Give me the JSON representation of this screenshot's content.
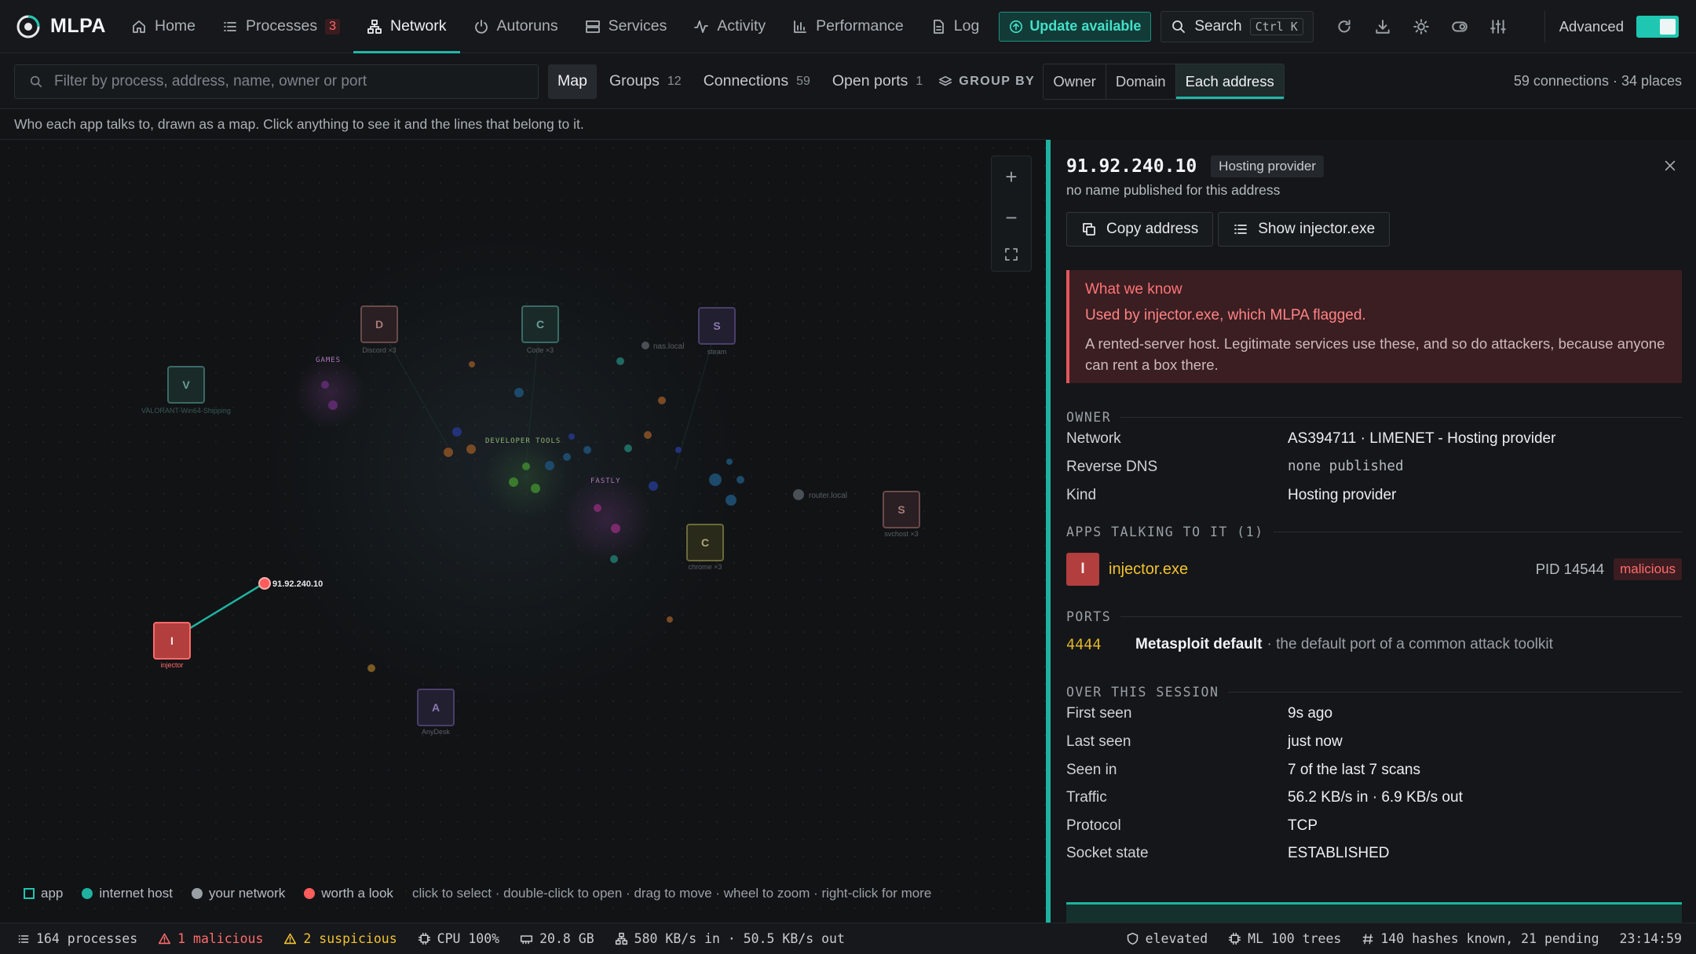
{
  "app": {
    "name": "MLPA"
  },
  "nav": [
    {
      "label": "Home",
      "icon": "home-icon"
    },
    {
      "label": "Processes",
      "icon": "list-icon",
      "badge": "3"
    },
    {
      "label": "Network",
      "icon": "network-icon",
      "active": true
    },
    {
      "label": "Autoruns",
      "icon": "power-icon"
    },
    {
      "label": "Services",
      "icon": "server-icon"
    },
    {
      "label": "Activity",
      "icon": "activity-icon"
    },
    {
      "label": "Performance",
      "icon": "bar-chart-icon"
    },
    {
      "label": "Log",
      "icon": "file-icon"
    }
  ],
  "update_label": "Update available",
  "search": {
    "label": "Search",
    "shortcut": "Ctrl K"
  },
  "advanced_label": "Advanced",
  "filter": {
    "placeholder": "Filter by process, address, name, owner or port"
  },
  "tabs": [
    {
      "label": "Map",
      "count": "",
      "active": true
    },
    {
      "label": "Groups",
      "count": "12"
    },
    {
      "label": "Connections",
      "count": "59"
    },
    {
      "label": "Open ports",
      "count": "1"
    }
  ],
  "group_by": {
    "label": "GROUP BY",
    "options": [
      "Owner",
      "Domain",
      "Each address"
    ],
    "selected": "Each address"
  },
  "summary": "59 connections · 34 places",
  "hint": "Who each app talks to, drawn as a map. Click anything to see it and the lines that belong to it.",
  "map": {
    "group_labels": [
      "GAMES",
      "DEVELOPER TOOLS",
      "FASTLY"
    ],
    "apps": [
      {
        "letter": "D",
        "label": "Discord ×3",
        "color": "#6a3b3b"
      },
      {
        "letter": "C",
        "label": "Code ×3",
        "color": "#2e5a55"
      },
      {
        "letter": "S",
        "label": "steam",
        "color": "#4a3a6a"
      },
      {
        "letter": "V",
        "label": "VALORANT-Win64-Shipping",
        "color": "#2e5a55"
      },
      {
        "letter": "S",
        "label": "svchost ×3",
        "color": "#6a3b3b"
      },
      {
        "letter": "C",
        "label": "chrome ×3",
        "color": "#5a5a2e"
      },
      {
        "letter": "I",
        "label": "injector",
        "color": "#b23e3e"
      },
      {
        "letter": "A",
        "label": "AnyDesk",
        "color": "#4a3a6a"
      }
    ],
    "local_hosts": [
      "nas.local",
      "router.local"
    ],
    "selected_host": "91.92.240.10",
    "zoom_controls": [
      "+",
      "−",
      "⛶"
    ],
    "legend": [
      {
        "label": "app",
        "kind": "square",
        "color": "#1fc7b2"
      },
      {
        "label": "internet host",
        "kind": "dot",
        "color": "#1fb2a0"
      },
      {
        "label": "your network",
        "kind": "dot",
        "color": "#9aa0a6"
      },
      {
        "label": "worth a look",
        "kind": "dot",
        "color": "#ff5c5c"
      }
    ],
    "legend_hint": "click to select · double-click to open · drag to move · wheel to zoom · right-click for more"
  },
  "panel": {
    "ip": "91.92.240.10",
    "tag": "Hosting provider",
    "subtitle": "no name published for this address",
    "buttons": {
      "copy": "Copy address",
      "show": "Show injector.exe"
    },
    "alert": {
      "title": "What we know",
      "line1": "Used by injector.exe, which MLPA flagged.",
      "line2": "A rented-server host. Legitimate services use these, and so do attackers, because anyone can rent a box there."
    },
    "owner_label": "OWNER",
    "owner": [
      {
        "k": "Network",
        "v": "AS394711 · LIMENET - Hosting provider"
      },
      {
        "k": "Reverse DNS",
        "v": "none published",
        "mono": true
      },
      {
        "k": "Kind",
        "v": "Hosting provider"
      }
    ],
    "apps_label": "APPS TALKING TO IT (1)",
    "app": {
      "letter": "I",
      "name": "injector.exe",
      "pid": "PID 14544",
      "badge": "malicious"
    },
    "ports_label": "PORTS",
    "port": {
      "num": "4444",
      "name": "Metasploit default",
      "desc": "· the default port of a common attack toolkit"
    },
    "session_label": "OVER THIS SESSION",
    "session": [
      {
        "k": "First seen",
        "v": "9s ago"
      },
      {
        "k": "Last seen",
        "v": "just now"
      },
      {
        "k": "Seen in",
        "v": "7 of the last 7 scans"
      },
      {
        "k": "Traffic",
        "v": "56.2 KB/s in · 6.9 KB/s out"
      },
      {
        "k": "Protocol",
        "v": "TCP"
      },
      {
        "k": "Socket state",
        "v": "ESTABLISHED"
      }
    ]
  },
  "status": {
    "processes": "164 processes",
    "malicious": "1 malicious",
    "suspicious": "2 suspicious",
    "cpu": "CPU 100%",
    "ram": "20.8 GB",
    "net": "580 KB/s in · 50.5 KB/s out",
    "elevated": "elevated",
    "ml": "ML 100 trees",
    "hashes": "140 hashes known, 21 pending",
    "time": "23:14:59"
  }
}
